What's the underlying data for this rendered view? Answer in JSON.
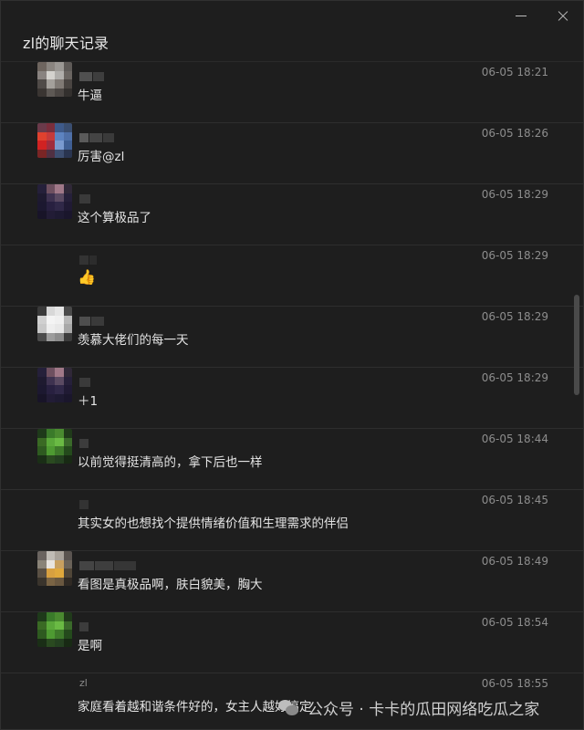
{
  "window": {
    "title": "zl的聊天记录"
  },
  "messages": [
    {
      "sender": "",
      "time": "06-05 18:21",
      "text": "牛逼"
    },
    {
      "sender": "",
      "time": "06-05 18:26",
      "text": "厉害@zl"
    },
    {
      "sender": "",
      "time": "06-05 18:29",
      "text": "这个算极品了"
    },
    {
      "sender": "",
      "time": "06-05 18:29",
      "text": "",
      "emoji": "👍"
    },
    {
      "sender": "",
      "time": "06-05 18:29",
      "text": "羡慕大佬们的每一天"
    },
    {
      "sender": "",
      "time": "06-05 18:29",
      "text": "＋1"
    },
    {
      "sender": "",
      "time": "06-05 18:44",
      "text": "以前觉得挺清高的，拿下后也一样"
    },
    {
      "sender": "",
      "time": "06-05 18:45",
      "text": "其实女的也想找个提供情绪价值和生理需求的伴侣"
    },
    {
      "sender": "",
      "time": "06-05 18:49",
      "text": "看图是真极品啊，肤白貌美，胸大"
    },
    {
      "sender": "",
      "time": "06-05 18:54",
      "text": "是啊"
    },
    {
      "sender": "zl",
      "time": "06-05 18:55",
      "text": "家庭看着越和谐条件好的，女主人越好搞定"
    }
  ],
  "watermark": {
    "text": "公众号 · 卡卡的瓜田网络吃瓜之家",
    "icon": "wechat-icon"
  },
  "colors": {
    "background": "#1e1e1e",
    "divider": "#2e2e2e",
    "text": "#e4e4e4",
    "muted": "#8d8d8d"
  }
}
